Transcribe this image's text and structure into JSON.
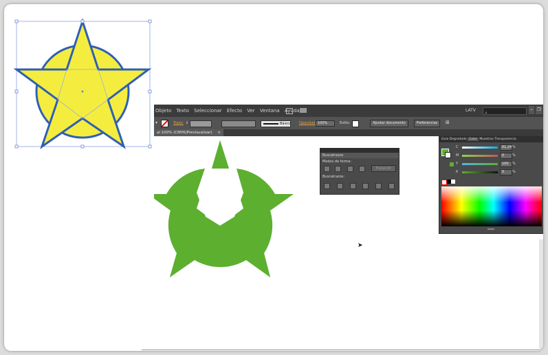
{
  "menu": {
    "items": [
      "Objeto",
      "Texto",
      "Seleccionar",
      "Efecto",
      "Ver",
      "Ventana",
      "Ayuda"
    ],
    "workspace_label": "LATV",
    "search_placeholder": ""
  },
  "control_bar": {
    "stroke_label": "Trazo:",
    "stroke_style_label": "Básico",
    "opacity_label": "Opacidad:",
    "opacity_value": "100%",
    "style_label": "Estilo:",
    "document_setup_button": "Ajustar documento",
    "preferences_button": "Preferencias"
  },
  "document_tab": {
    "label": "al 100% (CMYK/Previsualizar)",
    "close": "×"
  },
  "pathfinder_panel": {
    "title": "Buscatrazos",
    "shape_modes_label": "Modos de forma:",
    "expand_button": "Expandir",
    "pathfinders_label": "Buscatrazos:"
  },
  "color_panel": {
    "tabs": [
      "Guía",
      "Degradado",
      "Color",
      "Muestras",
      "Transparencia"
    ],
    "channels": [
      {
        "name": "C",
        "value": "61,24",
        "percent": "%"
      },
      {
        "name": "M",
        "value": "0",
        "percent": "%"
      },
      {
        "name": "Y",
        "value": "100",
        "percent": "%"
      },
      {
        "name": "K",
        "value": "0",
        "percent": "%"
      }
    ]
  },
  "colors": {
    "yellow_fill": "#f4ed3f",
    "blue_stroke": "#2f5fb5",
    "green_fill": "#5daf30",
    "dark_ui": "#3b3b3b"
  }
}
